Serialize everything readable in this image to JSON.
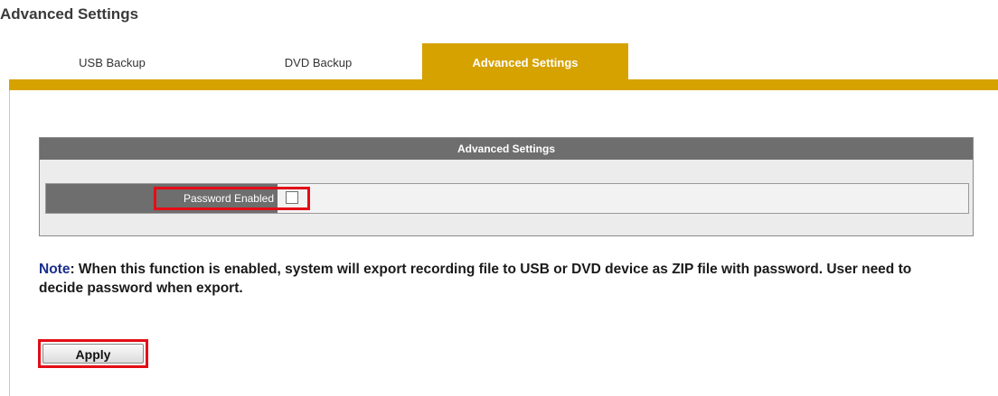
{
  "page": {
    "title": "Advanced Settings"
  },
  "tabs": [
    {
      "label": "USB Backup",
      "active": false
    },
    {
      "label": "DVD Backup",
      "active": false
    },
    {
      "label": "Advanced Settings",
      "active": true
    }
  ],
  "panel": {
    "header": "Advanced Settings",
    "password_enabled": {
      "label": "Password Enabled",
      "checked": false
    }
  },
  "note": {
    "prefix": "Note",
    "text": ": When this function is enabled, system will export recording file to USB or DVD device as ZIP file with password. User need to decide password when export."
  },
  "actions": {
    "apply_label": "Apply"
  },
  "colors": {
    "accent": "#d6a200",
    "panel_header": "#6e6e6e",
    "highlight": "#e30d16",
    "note_prefix": "#1b2f8c"
  }
}
